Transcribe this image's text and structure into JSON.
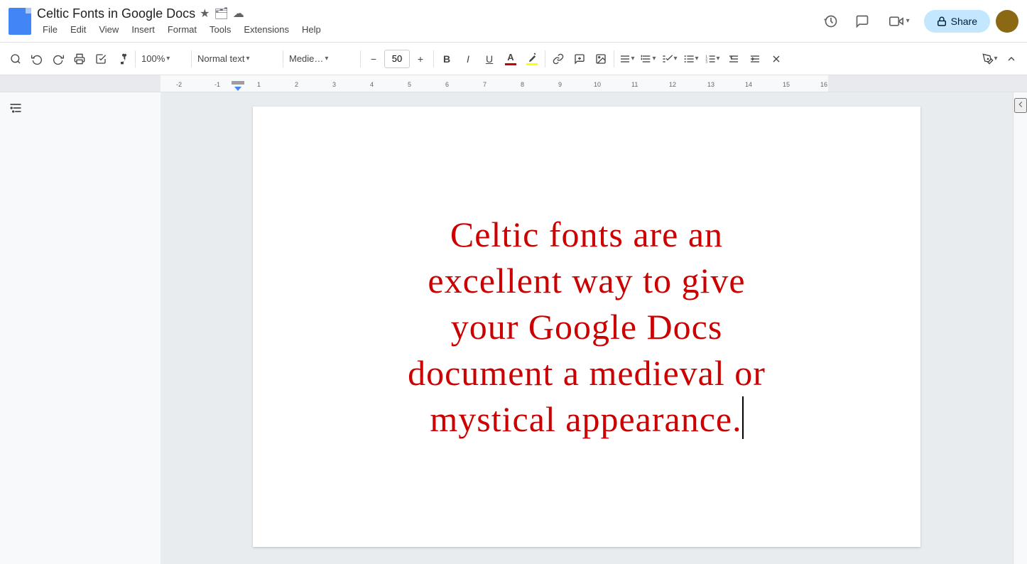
{
  "titleBar": {
    "docTitle": "Celtic Fonts in Google Docs",
    "starIcon": "★",
    "driveIcon": "🗂",
    "cloudIcon": "☁",
    "menuItems": [
      "File",
      "Edit",
      "View",
      "Insert",
      "Format",
      "Tools",
      "Extensions",
      "Help"
    ]
  },
  "titleActions": {
    "historyIcon": "🕐",
    "commentIcon": "💬",
    "meetingLabel": "📹",
    "shareLabel": "Share",
    "lockIcon": "🔒"
  },
  "toolbar": {
    "searchIcon": "🔍",
    "undoIcon": "↩",
    "redoIcon": "↪",
    "printIcon": "🖨",
    "checkIcon": "✓",
    "paintIcon": "🖌",
    "zoomLabel": "100%",
    "styleLabel": "Normal text",
    "fontLabel": "Medie…",
    "fontSizeValue": "50",
    "decrementLabel": "−",
    "incrementLabel": "+",
    "boldLabel": "B",
    "italicLabel": "I",
    "underlineLabel": "U",
    "textColorIcon": "A",
    "highlightIcon": "✏",
    "linkIcon": "🔗",
    "commentBtnIcon": "+💬",
    "imageIcon": "🖼",
    "alignIcon": "≡",
    "lineSpaceIcon": "↕",
    "listCheckIcon": "☑",
    "bulletIcon": "☰",
    "numListIcon": "1.",
    "indentLessIcon": "⇤",
    "indentMoreIcon": "⇥",
    "clearFormatIcon": "✕",
    "pencilIcon": "✏",
    "collapseIcon": "∧"
  },
  "document": {
    "content": "Celtic fonts are an excellent way to give your Google Docs document a medieval or mystical appearance.",
    "line1": "Celtic fonts are an",
    "line2": "excellent way to give",
    "line3": "your Google Docs",
    "line4": "document a medieval or",
    "line5": "mystical appearance.",
    "textColor": "#cc0000",
    "fontSize": "50px",
    "fontFamily": "MedievalSharp"
  },
  "outlineIcon": "☰"
}
